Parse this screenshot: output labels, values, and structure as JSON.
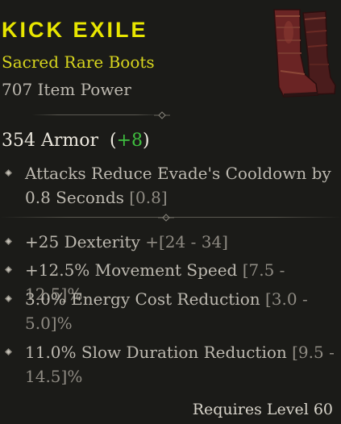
{
  "item": {
    "name": "KICK EXILE",
    "type": "Sacred Rare Boots",
    "power": "707 Item Power",
    "image_icon": "boots-icon"
  },
  "armor": {
    "value": "354 Armor",
    "paren_open": "(",
    "delta": "+8",
    "paren_close": ")"
  },
  "implicit": {
    "text_line1": "Attacks Reduce Evade's Cooldown by",
    "text_line2_value": "0.8 Seconds",
    "text_line2_range": "[0.8]"
  },
  "affixes": [
    {
      "text": "+25 Dexterity",
      "range": "+[24 - 34]"
    },
    {
      "text": "+12.5% Movement Speed",
      "range": "[7.5 - 12.5]%"
    },
    {
      "text_line1": "3.0% Energy Cost Reduction",
      "range_line1": "[3.0 -",
      "range_line2": "5.0]%"
    },
    {
      "text_line1": "11.0% Slow Duration Reduction",
      "range_line1": "[9.5 -",
      "range_line2": "14.5]%"
    }
  ],
  "requirement": "Requires Level 60",
  "colors": {
    "name": "#e8e600",
    "type": "#d8d61e",
    "delta": "#3fbf3f",
    "background": "#1b1b18"
  }
}
